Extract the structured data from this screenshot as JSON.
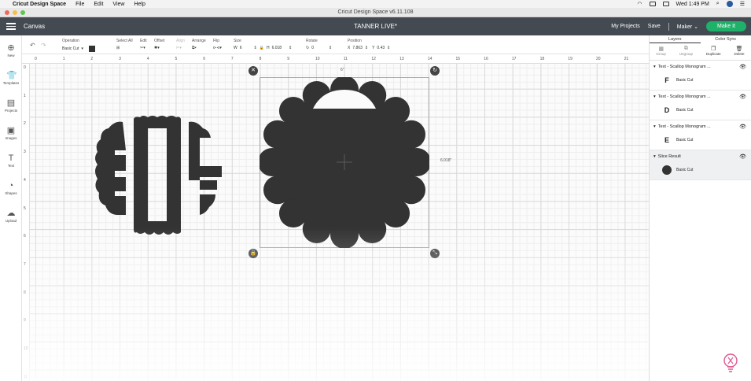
{
  "menubar": {
    "app_name": "Cricut Design Space",
    "menus": [
      "File",
      "Edit",
      "View",
      "Help"
    ],
    "clock": "Wed 1:49 PM"
  },
  "window": {
    "title": "Cricut Design Space  v6.11.108"
  },
  "appbar": {
    "canvas_label": "Canvas",
    "project_title": "TANNER LIVE*",
    "my_projects": "My Projects",
    "save": "Save",
    "machine": "Maker",
    "make_it": "Make It"
  },
  "toolbar": {
    "operation_label": "Operation",
    "operation_value": "Basic Cut",
    "select_all": "Select All",
    "edit": "Edit",
    "offset": "Offset",
    "align": "Align",
    "arrange": "Arrange",
    "flip": "Flip",
    "size": "Size",
    "w_label": "W",
    "w_value": "6",
    "h_label": "H",
    "h_value": "6.018",
    "rotate": "Rotate",
    "rotate_value": "0",
    "position": "Position",
    "x_label": "X",
    "x_value": "7.863",
    "y_label": "Y",
    "y_value": "0.43"
  },
  "sidebar": {
    "items": [
      {
        "label": "New",
        "icon": "plus-circle-icon"
      },
      {
        "label": "Templates",
        "icon": "shirt-icon"
      },
      {
        "label": "Projects",
        "icon": "projects-icon"
      },
      {
        "label": "Images",
        "icon": "image-icon"
      },
      {
        "label": "Text",
        "icon": "text-icon"
      },
      {
        "label": "Shapes",
        "icon": "shapes-icon"
      },
      {
        "label": "Upload",
        "icon": "upload-icon"
      }
    ]
  },
  "ruler": {
    "top_ticks": [
      "0",
      "1",
      "2",
      "3",
      "4",
      "5",
      "6",
      "7",
      "8",
      "9",
      "10",
      "11",
      "12",
      "13",
      "14",
      "15",
      "16",
      "17",
      "18",
      "19",
      "20",
      "21"
    ],
    "left_ticks": [
      "0",
      "1",
      "2",
      "3",
      "4",
      "5",
      "6",
      "7",
      "8",
      "9",
      "10",
      "11"
    ]
  },
  "canvas": {
    "width_dim": "6\"",
    "height_dim": "6.018\""
  },
  "layers": {
    "tabs": [
      "Layers",
      "Color Sync"
    ],
    "actions": [
      "Group",
      "Ungroup",
      "Duplicate",
      "Delete"
    ],
    "groups": [
      {
        "title": "Text - Scallop Monogram ...",
        "sub": "Basic Cut",
        "thumb": "F"
      },
      {
        "title": "Text - Scallop Monogram ...",
        "sub": "Basic Cut",
        "thumb": "D"
      },
      {
        "title": "Text - Scallop Monogram ...",
        "sub": "Basic Cut",
        "thumb": "E"
      },
      {
        "title": "Slice Result",
        "sub": "Basic Cut",
        "thumb": ""
      }
    ]
  },
  "colors": {
    "appbar": "#434a52",
    "make_it": "#1fb06a",
    "shape_fill": "#333333"
  }
}
